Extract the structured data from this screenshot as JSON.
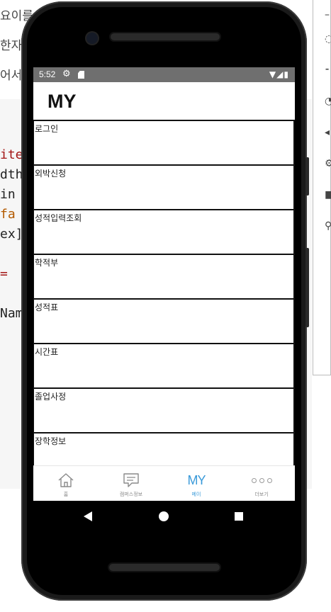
{
  "background": {
    "lines": [
      "요이를",
      "한자",
      "어서"
    ],
    "code_lines": [
      "ite",
      "dth",
      " in",
      "  fa",
      "ex]",
      "  =",
      "Nam"
    ]
  },
  "status_bar": {
    "time": "5:52",
    "icons": [
      "gear-icon",
      "sd-card-icon",
      "wifi-icon",
      "signal-icon",
      "battery-icon"
    ]
  },
  "header": {
    "title": "MY"
  },
  "menu": {
    "items": [
      {
        "label": "로그인"
      },
      {
        "label": "외박신청"
      },
      {
        "label": "성적입력조회"
      },
      {
        "label": "학적부"
      },
      {
        "label": "성적표"
      },
      {
        "label": "시간표"
      },
      {
        "label": "졸업사정"
      },
      {
        "label": "장학정보"
      }
    ]
  },
  "bottom_nav": {
    "items": [
      {
        "label": "홈",
        "icon": "home-icon",
        "active": false
      },
      {
        "label": "캠퍼스정보",
        "icon": "chat-icon",
        "active": false
      },
      {
        "label": "메이",
        "icon": "my-icon",
        "active": true
      },
      {
        "label": "더보기",
        "icon": "more-icon",
        "active": false
      }
    ]
  },
  "colors": {
    "accent": "#3a9ad9",
    "status_bar": "#6f6f6f",
    "divider": "#111111"
  }
}
